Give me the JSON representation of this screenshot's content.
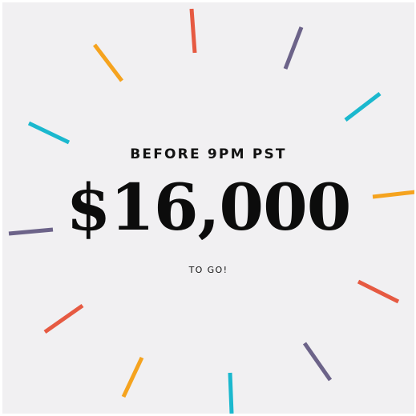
{
  "headline": {
    "before_text": "BEFORE 9PM PST",
    "amount": "$16,000",
    "after_text": "TO GO!"
  },
  "burst_colors": {
    "red": "#e65a42",
    "orange": "#f5a31f",
    "purple": "#6c6389",
    "teal": "#1bb8ce"
  }
}
